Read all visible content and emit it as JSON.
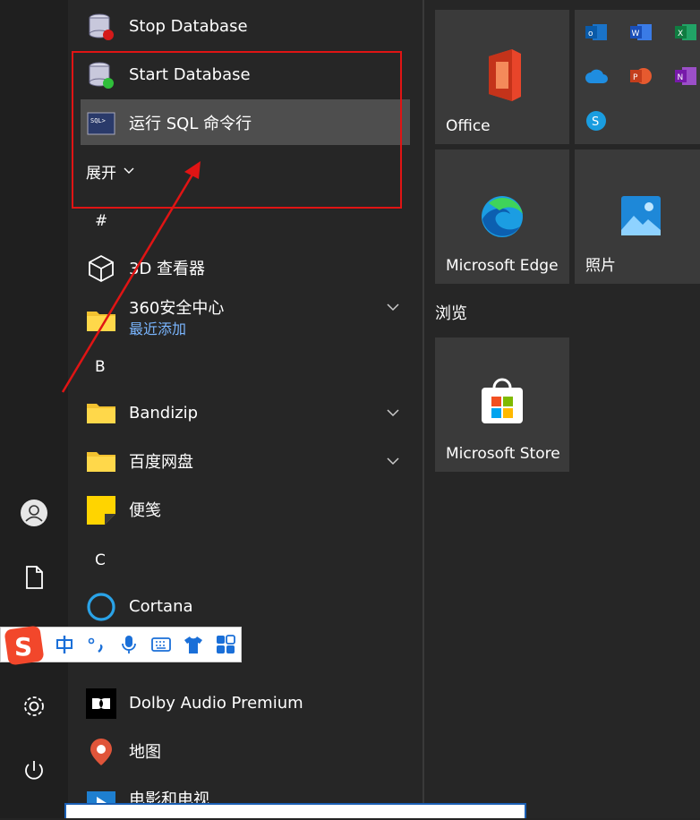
{
  "app_list": {
    "items": [
      {
        "label": "Stop Database"
      },
      {
        "label": "Start Database"
      },
      {
        "label": "运行 SQL 命令行"
      },
      {
        "label": "展开"
      },
      {
        "label": "#"
      },
      {
        "label": "3D 查看器"
      },
      {
        "label": "360安全中心",
        "sub": "最近添加"
      },
      {
        "label": "B"
      },
      {
        "label": "Bandizip"
      },
      {
        "label": "百度网盘"
      },
      {
        "label": "便笺"
      },
      {
        "label": "C"
      },
      {
        "label": "Cortana"
      },
      {
        "label": "Dolby Audio Premium"
      },
      {
        "label": "地图"
      },
      {
        "label": "电影和电视"
      }
    ]
  },
  "tiles": {
    "office": "Office",
    "edge": "Microsoft Edge",
    "photos": "照片",
    "group_browse": "浏览",
    "store": "Microsoft Store"
  },
  "colors": {
    "accent": "#0078d4",
    "annotation_red": "#e01414",
    "recent_blue": "#7ab6ff"
  }
}
